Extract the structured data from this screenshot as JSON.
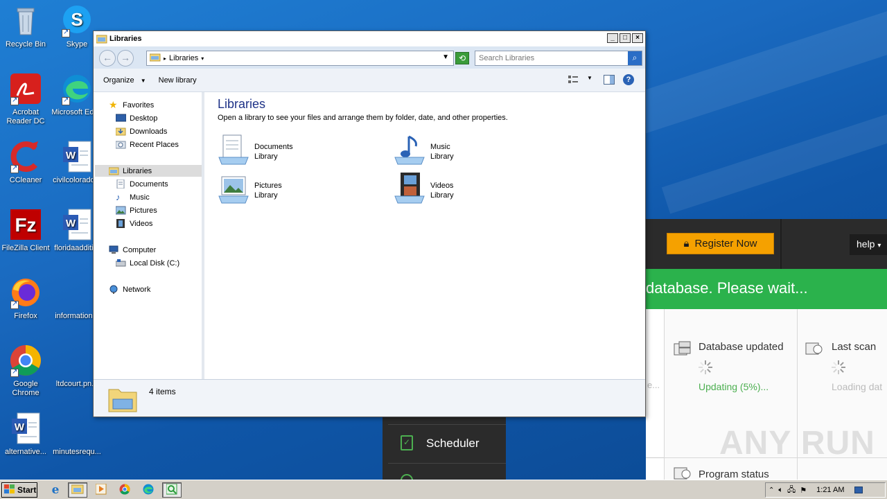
{
  "desktop": {
    "icons": [
      {
        "label": "Recycle Bin"
      },
      {
        "label": "Skype"
      },
      {
        "label": "Acrobat Reader DC"
      },
      {
        "label": "Microsoft Edge"
      },
      {
        "label": "CCleaner"
      },
      {
        "label": "civilcolorado..."
      },
      {
        "label": "FileZilla Client"
      },
      {
        "label": "floridaadditi..."
      },
      {
        "label": "Firefox"
      },
      {
        "label": "information..."
      },
      {
        "label": "Google Chrome"
      },
      {
        "label": "ltdcourt.pn..."
      },
      {
        "label": "alternative..."
      },
      {
        "label": "minutesrequ..."
      }
    ]
  },
  "bgapp": {
    "register_label": "Register Now",
    "help_label": "help",
    "banner": "database. Please wait...",
    "db_title": "Database updated",
    "db_status": "Updating (5%)...",
    "last_scan_title": "Last scan",
    "last_scan_status": "Loading dat",
    "scheduler_label": "Scheduler",
    "program_status_title": "Program status",
    "partial_text": "e..."
  },
  "explorer": {
    "title": "Libraries",
    "address": "Libraries",
    "search_placeholder": "Search Libraries",
    "toolbar": {
      "organize": "Organize",
      "new_library": "New library"
    },
    "nav": {
      "favorites": "Favorites",
      "desktop": "Desktop",
      "downloads": "Downloads",
      "recent": "Recent Places",
      "libraries": "Libraries",
      "documents": "Documents",
      "music": "Music",
      "pictures": "Pictures",
      "videos": "Videos",
      "computer": "Computer",
      "local_disk": "Local Disk (C:)",
      "network": "Network"
    },
    "heading": "Libraries",
    "description": "Open a library to see your files and arrange them by folder, date, and other properties.",
    "libraries": [
      {
        "name": "Documents",
        "type": "Library"
      },
      {
        "name": "Music",
        "type": "Library"
      },
      {
        "name": "Pictures",
        "type": "Library"
      },
      {
        "name": "Videos",
        "type": "Library"
      }
    ],
    "status": "4 items"
  },
  "taskbar": {
    "start_label": "Start",
    "clock": "1:21 AM"
  },
  "watermark": "ANY RUN"
}
